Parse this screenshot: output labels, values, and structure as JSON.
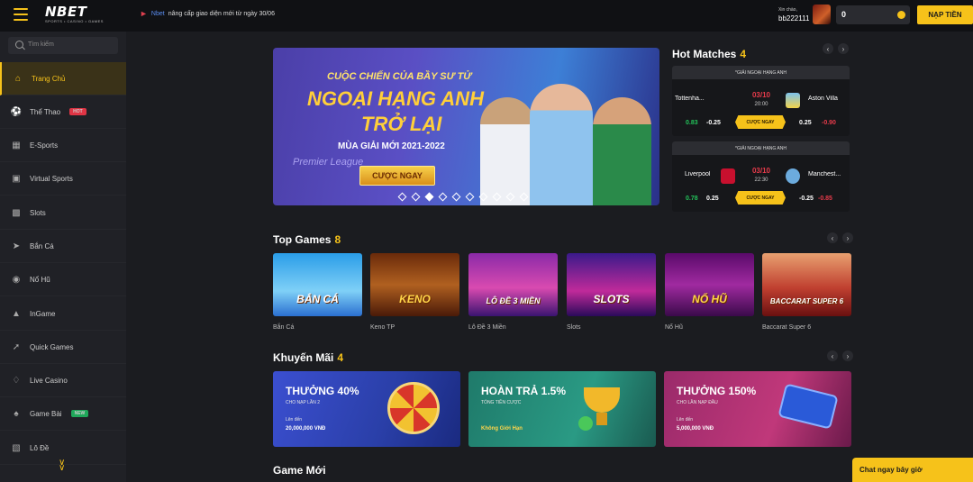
{
  "header": {
    "logo_brand": "NBET",
    "logo_sub": "SPORTS • CASINO • GAMES",
    "notice_brand": "Nbet",
    "notice_text": "nâng cấp giao diện mới từ ngày 30/06",
    "greeting": "Xin chào,",
    "username": "bb222111",
    "balance": "0",
    "deposit_label": "NẠP TIỀN"
  },
  "sidebar": {
    "search_placeholder": "Tìm kiếm",
    "items": [
      {
        "label": "Trang Chủ",
        "icon": "home-icon",
        "active": true
      },
      {
        "label": "Thể Thao",
        "icon": "soccer-ball-icon",
        "badge": "HOT"
      },
      {
        "label": "E-Sports",
        "icon": "gamepad-icon"
      },
      {
        "label": "Virtual Sports",
        "icon": "virtual-sports-icon"
      },
      {
        "label": "Slots",
        "icon": "slots-icon"
      },
      {
        "label": "Bắn Cá",
        "icon": "fish-icon"
      },
      {
        "label": "Nổ Hũ",
        "icon": "jackpot-icon"
      },
      {
        "label": "InGame",
        "icon": "ingame-icon"
      },
      {
        "label": "Quick Games",
        "icon": "rocket-icon"
      },
      {
        "label": "Live Casino",
        "icon": "live-casino-icon"
      },
      {
        "label": "Game Bài",
        "icon": "cards-icon",
        "badge": "NEW"
      },
      {
        "label": "Lô Đề",
        "icon": "lottery-icon"
      }
    ]
  },
  "banner": {
    "headline_top": "CUỘC CHIẾN CỦA BẦY SƯ TỬ",
    "headline_1": "NGOẠI HẠNG ANH",
    "headline_2": "TRỞ LẠI",
    "season": "MÙA GIẢI MỚI 2021-2022",
    "cta": "CƯỢC NGAY",
    "league_logo": "Premier League",
    "slide_count": 10,
    "active_slide": 3
  },
  "hot_matches": {
    "title": "Hot Matches",
    "count": "4",
    "matches": [
      {
        "league": "*GIẢI NGOẠI HẠNG ANH",
        "home": "Tottenha...",
        "away": "Aston Villa",
        "date": "03/10",
        "time": "20:00",
        "odd1": "0.83",
        "hcp1": "-0.25",
        "odd2": "0.25",
        "hcp2": "-0.90",
        "bet_label": "CƯỢC NGAY"
      },
      {
        "league": "*GIẢI NGOẠI HẠNG ANH",
        "home": "Liverpool",
        "away": "Manchest...",
        "date": "03/10",
        "time": "22:30",
        "odd1": "0.78",
        "hcp1": "0.25",
        "odd2": "-0.25",
        "hcp2": "-0.85",
        "bet_label": "CƯỢC NGAY"
      }
    ]
  },
  "top_games": {
    "title": "Top Games",
    "count": "8",
    "games": [
      {
        "label": "Bắn Cá",
        "art": "BẮN CÁ"
      },
      {
        "label": "Keno TP",
        "art": "KENO"
      },
      {
        "label": "Lô Đề 3 Miền",
        "art": "LÔ ĐỀ 3 MIỀN"
      },
      {
        "label": "Slots",
        "art": "SLOTS"
      },
      {
        "label": "Nổ Hũ",
        "art": "NỔ HŨ"
      },
      {
        "label": "Baccarat Super 6",
        "art": "BACCARAT SUPER 6"
      }
    ]
  },
  "promotions": {
    "title": "Khuyến Mãi",
    "count": "4",
    "items": [
      {
        "title": "THƯỞNG 40%",
        "sub": "CHO NẠP LẦN 2",
        "line1": "Lên đến",
        "line2": "20,000,000 VNĐ"
      },
      {
        "title": "HOÀN TRẢ 1.5%",
        "sub": "TỔNG TIỀN CƯỢC",
        "line1": "",
        "line2": "Không Giới Hạn"
      },
      {
        "title": "THƯỞNG 150%",
        "sub": "CHO LẦN NẠP ĐẦU",
        "line1": "Lên đến",
        "line2": "5,000,000 VNĐ"
      }
    ]
  },
  "new_games": {
    "title": "Game Mới"
  },
  "chat": {
    "label": "Chat ngay bây giờ"
  },
  "colors": {
    "accent": "#f6c21a",
    "hot": "#e03545",
    "new": "#1fa85a",
    "positive": "#23c35a",
    "negative": "#e83b4b"
  }
}
